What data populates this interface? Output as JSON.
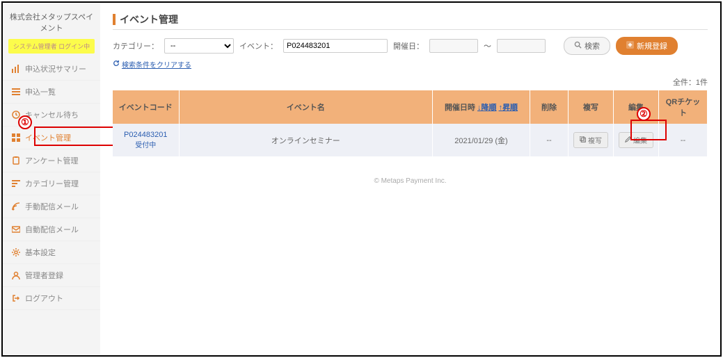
{
  "brand": "株式会社メタップスペイメント",
  "login_status": "システム管理者 ログイン中",
  "sidebar": {
    "items": [
      {
        "label": "申込状況サマリー"
      },
      {
        "label": "申込一覧"
      },
      {
        "label": "キャンセル待ち"
      },
      {
        "label": "イベント管理"
      },
      {
        "label": "アンケート管理"
      },
      {
        "label": "カテゴリー管理"
      },
      {
        "label": "手動配信メール"
      },
      {
        "label": "自動配信メール"
      },
      {
        "label": "基本設定"
      },
      {
        "label": "管理者登録"
      },
      {
        "label": "ログアウト"
      }
    ]
  },
  "page": {
    "title": "イベント管理"
  },
  "filters": {
    "category_label": "カテゴリー：",
    "category_selected": "--",
    "event_label": "イベント：",
    "event_value": "P024483201",
    "date_label": "開催日：",
    "date_from": "",
    "date_to": "",
    "date_sep": "～",
    "search_label": "検索",
    "new_label": "新規登録",
    "clear_label": "検索条件をクリアする"
  },
  "count": {
    "label": "全件：1件"
  },
  "table": {
    "headers": {
      "code": "イベントコード",
      "name": "イベント名",
      "date": "開催日時",
      "date_sort_desc": "↓降順",
      "date_sort_asc": "↑昇順",
      "delete": "削除",
      "copy": "複写",
      "edit": "編集",
      "qr": "QRチケット"
    },
    "rows": [
      {
        "code": "P024483201",
        "status": "受付中",
        "name": "オンラインセミナー",
        "date": "2021/01/29 (金)",
        "delete": "--",
        "copy_label": "複写",
        "edit_label": "編集",
        "qr": "--"
      }
    ]
  },
  "footer": "© Metaps Payment Inc.",
  "annotations": {
    "one": "①",
    "two": "②"
  }
}
